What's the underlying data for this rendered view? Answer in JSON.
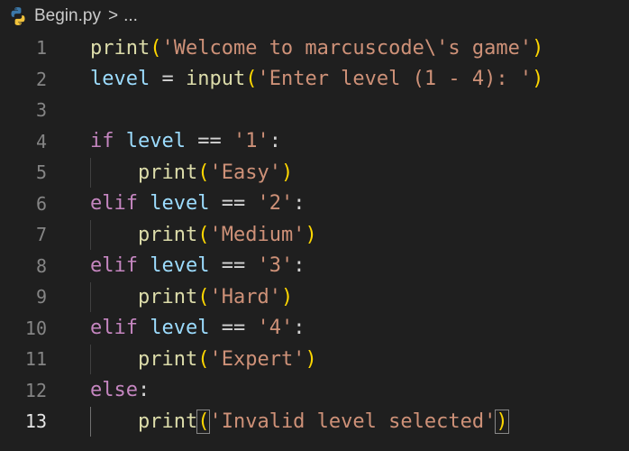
{
  "breadcrumb": {
    "filename": "Begin.py",
    "separator": ">",
    "more": "..."
  },
  "editor": {
    "active_line": 13,
    "lines": [
      {
        "number": "1",
        "tokens": [
          [
            "fn",
            "print"
          ],
          [
            "paren",
            "("
          ],
          [
            "str",
            "'Welcome to marcuscode\\'s game'"
          ],
          [
            "paren",
            ")"
          ]
        ]
      },
      {
        "number": "2",
        "tokens": [
          [
            "var",
            "level"
          ],
          [
            "op",
            " = "
          ],
          [
            "fn",
            "input"
          ],
          [
            "paren",
            "("
          ],
          [
            "str",
            "'Enter level (1 - 4): '"
          ],
          [
            "paren",
            ")"
          ]
        ]
      },
      {
        "number": "3",
        "tokens": []
      },
      {
        "number": "4",
        "tokens": [
          [
            "kw",
            "if"
          ],
          [
            "op",
            " "
          ],
          [
            "var",
            "level"
          ],
          [
            "op",
            " == "
          ],
          [
            "str",
            "'1'"
          ],
          [
            "op",
            ":"
          ]
        ]
      },
      {
        "number": "5",
        "tokens": [
          [
            "op",
            "    "
          ],
          [
            "fn",
            "print"
          ],
          [
            "paren",
            "("
          ],
          [
            "str",
            "'Easy'"
          ],
          [
            "paren",
            ")"
          ]
        ]
      },
      {
        "number": "6",
        "tokens": [
          [
            "kw",
            "elif"
          ],
          [
            "op",
            " "
          ],
          [
            "var",
            "level"
          ],
          [
            "op",
            " == "
          ],
          [
            "str",
            "'2'"
          ],
          [
            "op",
            ":"
          ]
        ]
      },
      {
        "number": "7",
        "tokens": [
          [
            "op",
            "    "
          ],
          [
            "fn",
            "print"
          ],
          [
            "paren",
            "("
          ],
          [
            "str",
            "'Medium'"
          ],
          [
            "paren",
            ")"
          ]
        ]
      },
      {
        "number": "8",
        "tokens": [
          [
            "kw",
            "elif"
          ],
          [
            "op",
            " "
          ],
          [
            "var",
            "level"
          ],
          [
            "op",
            " == "
          ],
          [
            "str",
            "'3'"
          ],
          [
            "op",
            ":"
          ]
        ]
      },
      {
        "number": "9",
        "tokens": [
          [
            "op",
            "    "
          ],
          [
            "fn",
            "print"
          ],
          [
            "paren",
            "("
          ],
          [
            "str",
            "'Hard'"
          ],
          [
            "paren",
            ")"
          ]
        ]
      },
      {
        "number": "10",
        "tokens": [
          [
            "kw",
            "elif"
          ],
          [
            "op",
            " "
          ],
          [
            "var",
            "level"
          ],
          [
            "op",
            " == "
          ],
          [
            "str",
            "'4'"
          ],
          [
            "op",
            ":"
          ]
        ]
      },
      {
        "number": "11",
        "tokens": [
          [
            "op",
            "    "
          ],
          [
            "fn",
            "print"
          ],
          [
            "paren",
            "("
          ],
          [
            "str",
            "'Expert'"
          ],
          [
            "paren",
            ")"
          ]
        ]
      },
      {
        "number": "12",
        "tokens": [
          [
            "kw",
            "else"
          ],
          [
            "op",
            ":"
          ]
        ]
      },
      {
        "number": "13",
        "tokens": [
          [
            "op",
            "    "
          ],
          [
            "fn",
            "print"
          ],
          [
            "paren",
            "("
          ],
          [
            "str",
            "'Invalid level selected'"
          ],
          [
            "paren",
            ")"
          ]
        ]
      }
    ]
  },
  "colors": {
    "background": "#1f1f1f",
    "keyword": "#c586c0",
    "function": "#dcdcaa",
    "variable": "#9cdcfe",
    "string": "#ce9178",
    "bracket": "#ffd700",
    "line_number": "#858585"
  },
  "icons": {
    "file_icon": "python-icon",
    "separator_icon": "chevron-right-icon"
  }
}
